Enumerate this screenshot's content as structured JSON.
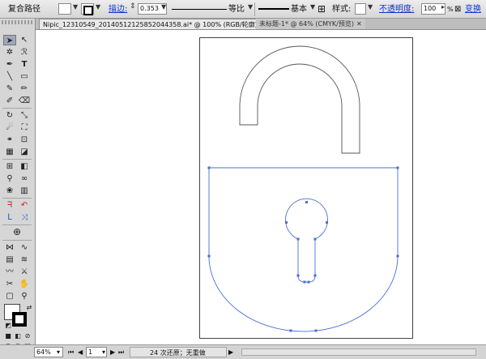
{
  "control_bar": {
    "object_label": "复合路径",
    "stroke_label": "描边:",
    "stroke_value": "0.353",
    "profile_label": "等比",
    "brush_label": "基本",
    "style_label": "样式:",
    "opacity_label": "不透明度:",
    "opacity_value": "100",
    "opacity_unit": "%",
    "transform_label": "变换"
  },
  "tabs": [
    {
      "label": "Nipic_12310549_20140512125852044358.ai* @ 100% (RGB/轮廓)",
      "active": true
    },
    {
      "label": "未标题-1* @ 64% (CMYK/预览)",
      "active": false
    }
  ],
  "status_bar": {
    "zoom": "64%",
    "artboard": "1",
    "undo_info": "24 次还原；无重做"
  },
  "colors": {
    "selection": "#4a6fd0",
    "outline": "#555555",
    "panel": "#d6d6d6",
    "link": "#1533c8"
  },
  "icons": {
    "close": "close-icon",
    "dropdown": "chevron-down-icon",
    "selection_tool": "arrow-icon"
  }
}
